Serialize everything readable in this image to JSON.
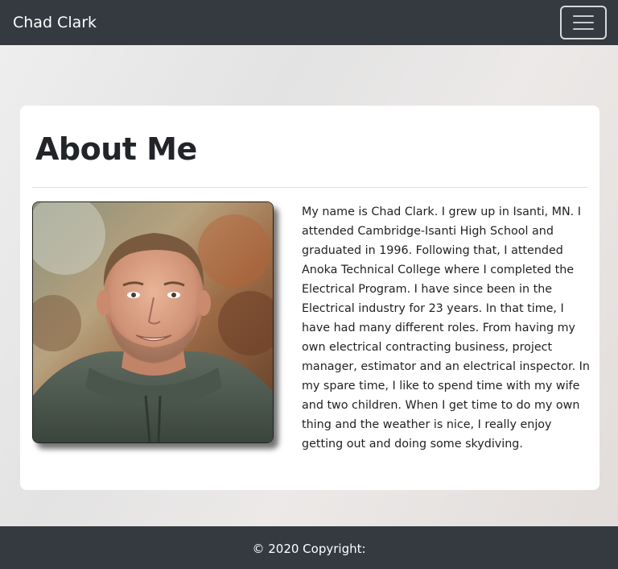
{
  "navbar": {
    "brand": "Chad Clark",
    "toggler_icon": "hamburger-menu-icon"
  },
  "about": {
    "heading": "About Me",
    "photo_subject": "portrait photo",
    "bio": "My name is Chad Clark. I grew up in Isanti, MN. I attended Cambridge-Isanti High School and graduated in 1996. Following that, I attended Anoka Technical College where I completed the Electrical Program. I have since been in the Electrical industry for 23 years. In that time, I have had many different roles. From having my own electrical contracting business, project manager, estimator and an electrical inspector. In my spare time, I like to spend time with my wife and two children. When I get time to do my own thing and the weather is nice, I really enjoy getting out and doing some skydiving."
  },
  "footer": {
    "copyright": "© 2020 Copyright:"
  },
  "colors": {
    "navbar_bg": "#343a40",
    "footer_bg": "#343a40",
    "card_bg": "#ffffff",
    "text": "#212529"
  }
}
